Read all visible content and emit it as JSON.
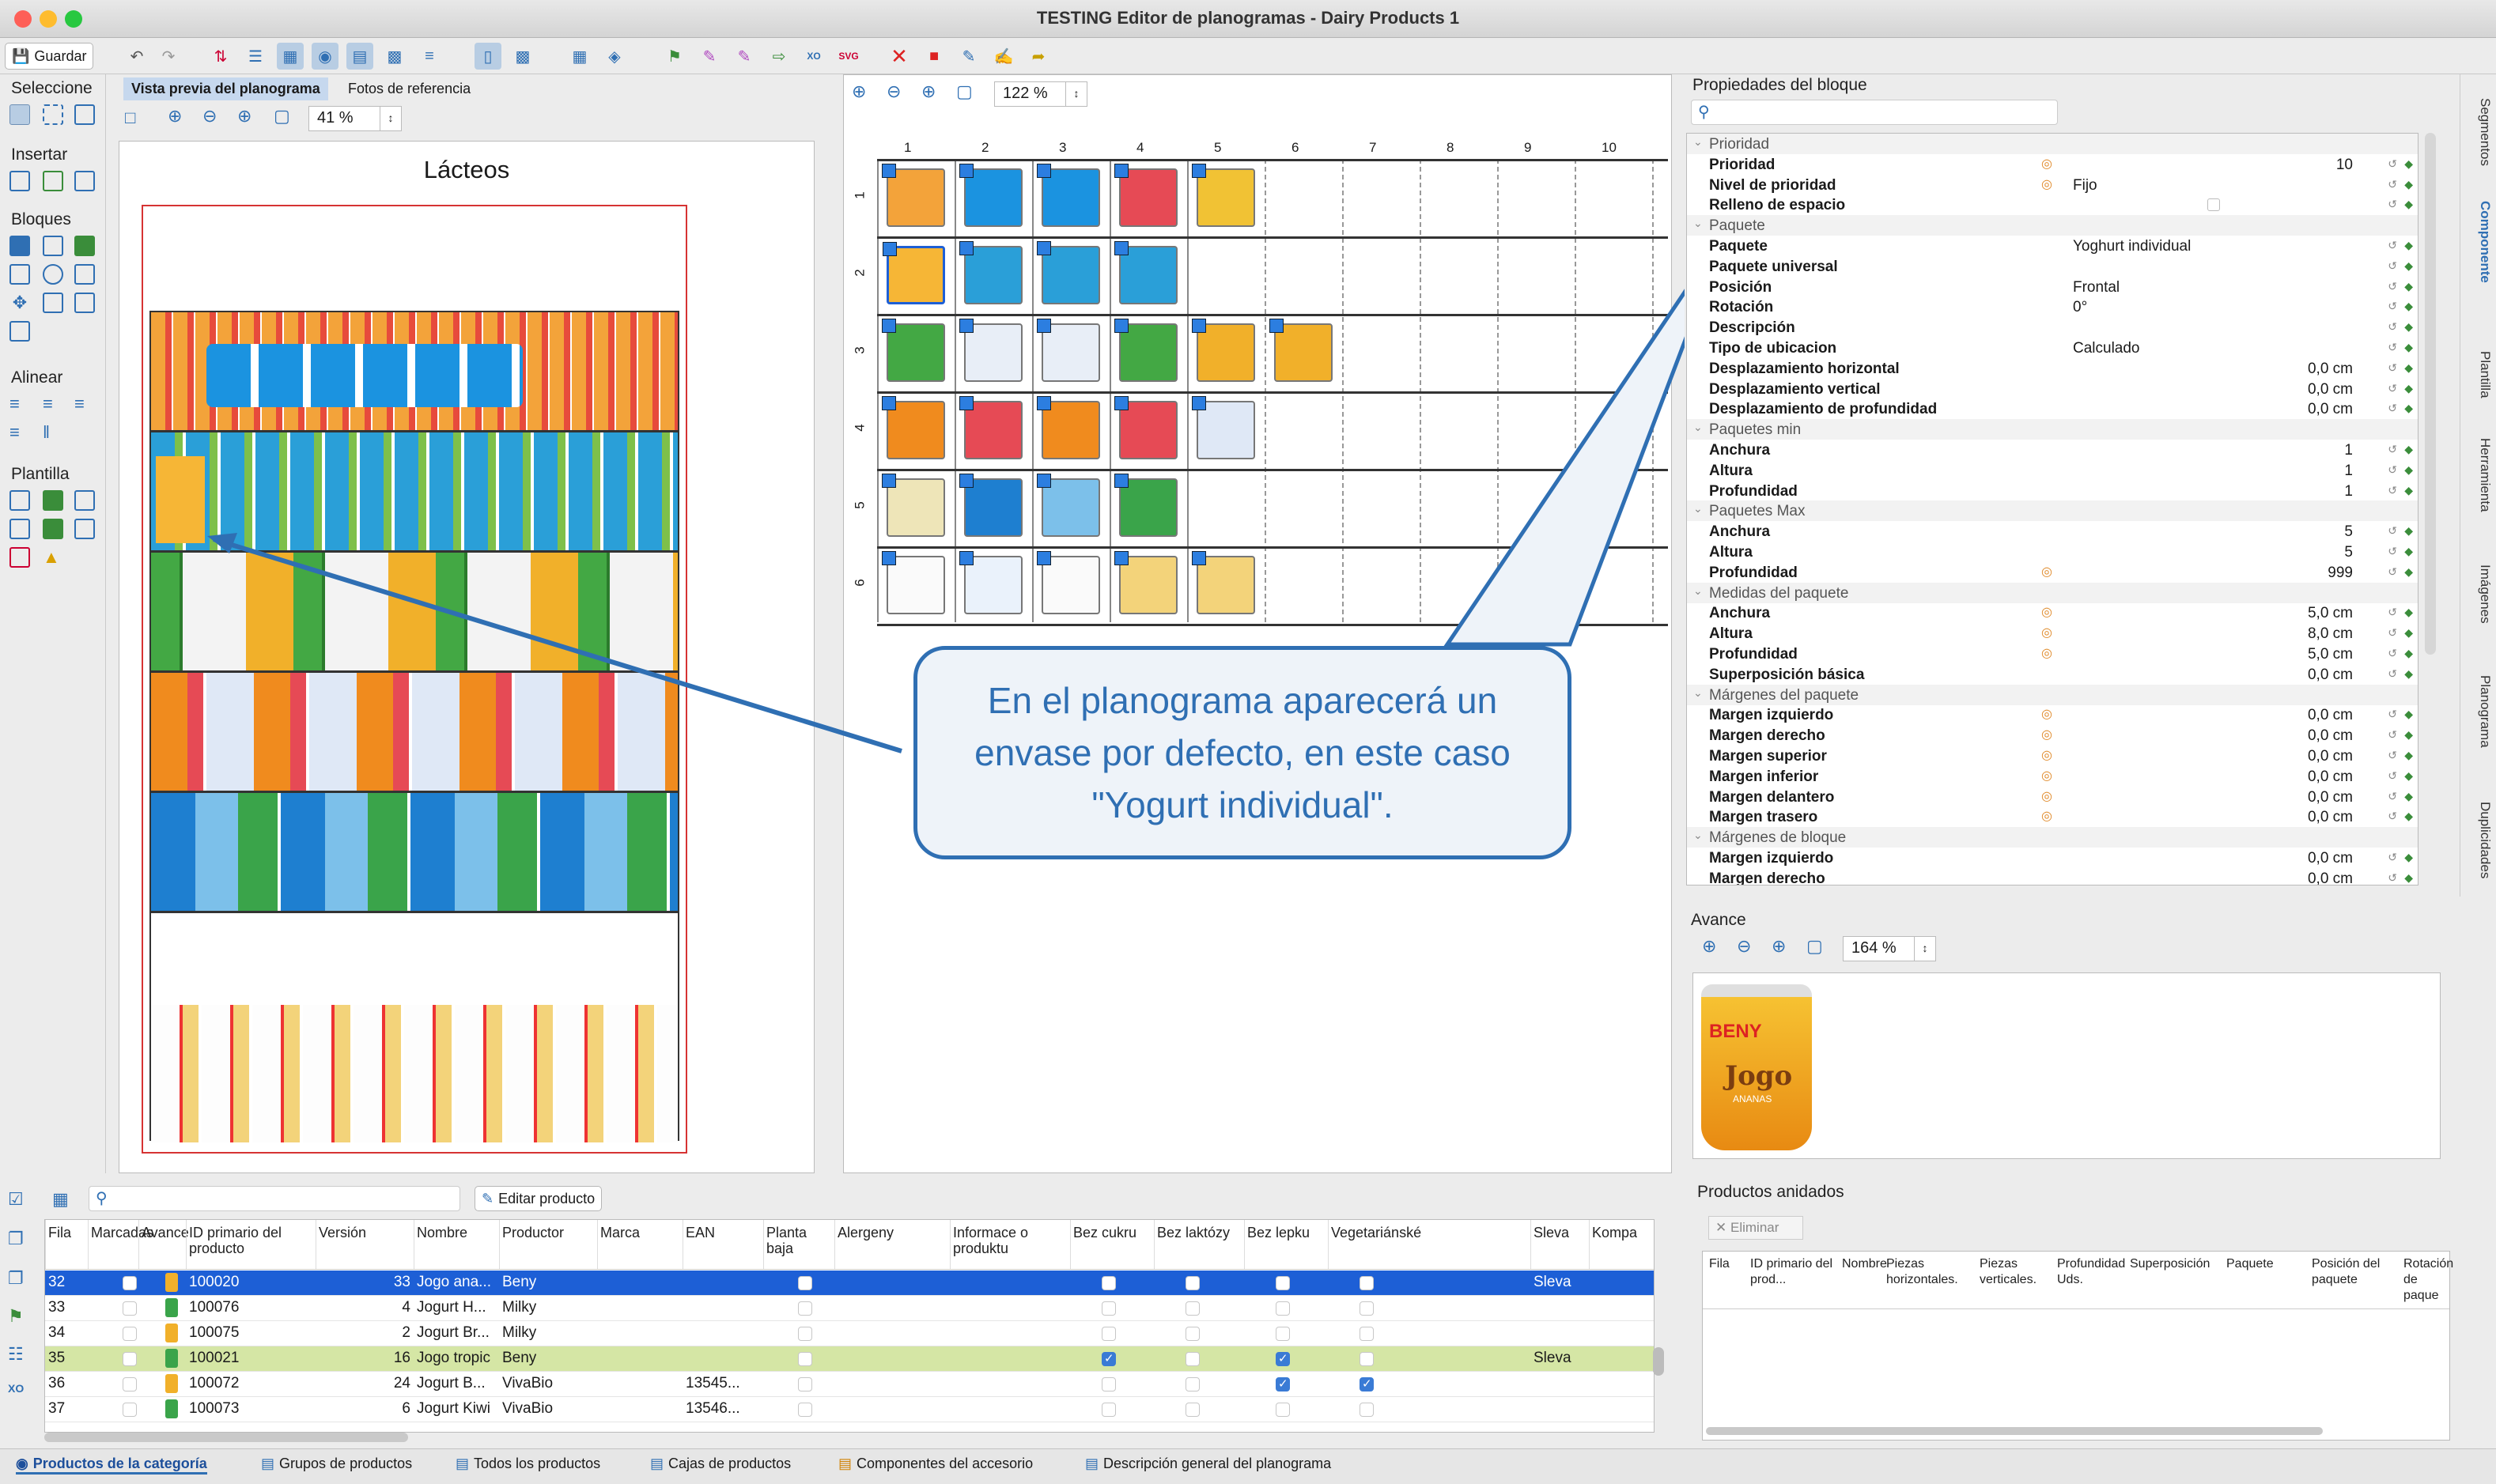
{
  "window": {
    "title": "TESTING Editor de planogramas - Dairy Products 1"
  },
  "toolbar": {
    "save_label": "Guardar"
  },
  "left_palette": {
    "sections": [
      "Seleccione",
      "Insertar",
      "Bloques",
      "Alinear",
      "Plantilla"
    ]
  },
  "preview_pane": {
    "tabs": [
      "Vista previa del planograma",
      "Fotos de referencia"
    ],
    "zoom": "41 %",
    "shelf_title": "Lácteos"
  },
  "canvas": {
    "zoom": "122 %",
    "columns": [
      "1",
      "2",
      "3",
      "4",
      "5",
      "6",
      "7",
      "8",
      "9",
      "10"
    ],
    "rows": [
      "1",
      "2",
      "3",
      "4",
      "5",
      "6"
    ]
  },
  "callout": {
    "text": "En el planograma aparecerá un envase por defecto, en este caso \"Yogurt individual\"."
  },
  "properties": {
    "title": "Propiedades del bloque",
    "rows": [
      {
        "type": "cat",
        "label": "Prioridad"
      },
      {
        "label": "Prioridad",
        "num": "10"
      },
      {
        "label": "Nivel de prioridad",
        "val": "Fijo"
      },
      {
        "label": "Relleno de espacio",
        "check": true
      },
      {
        "type": "cat",
        "label": "Paquete"
      },
      {
        "label": "Paquete",
        "val": "Yoghurt individual"
      },
      {
        "label": "Paquete universal"
      },
      {
        "label": "Posición",
        "val": "Frontal"
      },
      {
        "label": "Rotación",
        "val": "0°"
      },
      {
        "label": "Descripción"
      },
      {
        "label": "Tipo de ubicacion",
        "val": "Calculado"
      },
      {
        "label": "Desplazamiento horizontal",
        "num": "0,0 cm"
      },
      {
        "label": "Desplazamiento vertical",
        "num": "0,0 cm"
      },
      {
        "label": "Desplazamiento de profundidad",
        "num": "0,0 cm"
      },
      {
        "type": "cat",
        "label": "Paquetes min"
      },
      {
        "label": "Anchura",
        "num": "1"
      },
      {
        "label": "Altura",
        "num": "1"
      },
      {
        "label": "Profundidad",
        "num": "1"
      },
      {
        "type": "cat",
        "label": "Paquetes Max"
      },
      {
        "label": "Anchura",
        "num": "5"
      },
      {
        "label": "Altura",
        "num": "5"
      },
      {
        "label": "Profundidad",
        "num": "999"
      },
      {
        "type": "cat",
        "label": "Medidas del paquete"
      },
      {
        "label": "Anchura",
        "num": "5,0 cm"
      },
      {
        "label": "Altura",
        "num": "8,0 cm"
      },
      {
        "label": "Profundidad",
        "num": "5,0 cm"
      },
      {
        "label": "Superposición básica",
        "num": "0,0 cm"
      },
      {
        "type": "cat",
        "label": "Márgenes del paquete"
      },
      {
        "label": "Margen izquierdo",
        "num": "0,0 cm"
      },
      {
        "label": "Margen derecho",
        "num": "0,0 cm"
      },
      {
        "label": "Margen superior",
        "num": "0,0 cm"
      },
      {
        "label": "Margen inferior",
        "num": "0,0 cm"
      },
      {
        "label": "Margen delantero",
        "num": "0,0 cm"
      },
      {
        "label": "Margen trasero",
        "num": "0,0 cm"
      },
      {
        "type": "cat",
        "label": "Márgenes de bloque"
      },
      {
        "label": "Margen izquierdo",
        "num": "0,0 cm"
      },
      {
        "label": "Margen derecho",
        "num": "0,0 cm"
      }
    ]
  },
  "avance": {
    "title": "Avance",
    "zoom": "164 %",
    "brand": "BENY",
    "product": "Jogo",
    "flavor": "ANANAS"
  },
  "productos_anidados": {
    "title": "Productos anidados",
    "delete_label": "Eliminar",
    "columns": [
      "Fila",
      "ID primario del prod...",
      "Nombre",
      "Piezas horizontales.",
      "Piezas verticales.",
      "Profundidad Uds.",
      "Superposición",
      "Paquete",
      "Posición del paquete",
      "Rotación de paque"
    ]
  },
  "product_table": {
    "edit_label": "Editar producto",
    "columns": [
      "Fila",
      "Marcadas",
      "Avance",
      "ID primario del producto",
      "Versión",
      "Nombre",
      "Productor",
      "Marca",
      "EAN",
      "Planta baja",
      "Alergeny",
      "Informace o produktu",
      "Bez cukru",
      "Bez laktózy",
      "Bez lepku",
      "Vegetariánské",
      "Sleva",
      "Kompa"
    ],
    "rows": [
      {
        "fila": "32",
        "id": "100020",
        "version": "33",
        "name": "Jogo ana...",
        "producer": "Beny",
        "ean": "",
        "flags": [
          false,
          false,
          false,
          false
        ],
        "sleva": "Sleva",
        "style": "selected"
      },
      {
        "fila": "33",
        "id": "100076",
        "version": "4",
        "name": "Jogurt H...",
        "producer": "Milky",
        "ean": "",
        "flags": [
          false,
          false,
          false,
          false
        ],
        "sleva": "",
        "style": ""
      },
      {
        "fila": "34",
        "id": "100075",
        "version": "2",
        "name": "Jogurt Br...",
        "producer": "Milky",
        "ean": "",
        "flags": [
          false,
          false,
          false,
          false
        ],
        "sleva": "",
        "style": ""
      },
      {
        "fila": "35",
        "id": "100021",
        "version": "16",
        "name": "Jogo tropic",
        "producer": "Beny",
        "ean": "",
        "flags": [
          true,
          false,
          true,
          false
        ],
        "sleva": "Sleva",
        "style": "green"
      },
      {
        "fila": "36",
        "id": "100072",
        "version": "24",
        "name": "Jogurt B...",
        "producer": "VivaBio",
        "ean": "13545...",
        "flags": [
          false,
          false,
          true,
          true
        ],
        "sleva": "",
        "style": ""
      },
      {
        "fila": "37",
        "id": "100073",
        "version": "6",
        "name": "Jogurt Kiwi",
        "producer": "VivaBio",
        "ean": "13546...",
        "flags": [
          false,
          false,
          false,
          false
        ],
        "sleva": "",
        "style": ""
      }
    ]
  },
  "status_tabs": [
    "Productos de la categoría",
    "Grupos de productos",
    "Todos los productos",
    "Cajas de productos",
    "Componentes del accesorio",
    "Descripción general del planograma"
  ],
  "side_tabs": [
    "Segmentos",
    "Componente",
    "Plantilla",
    "Herramienta",
    "Imágenes",
    "Planograma",
    "Duplicidades"
  ],
  "colors": {
    "accent": "#2f6fb3",
    "selection": "#1d5fd6",
    "green_row": "#d5e6a5",
    "shelf_red": "#d63333"
  }
}
